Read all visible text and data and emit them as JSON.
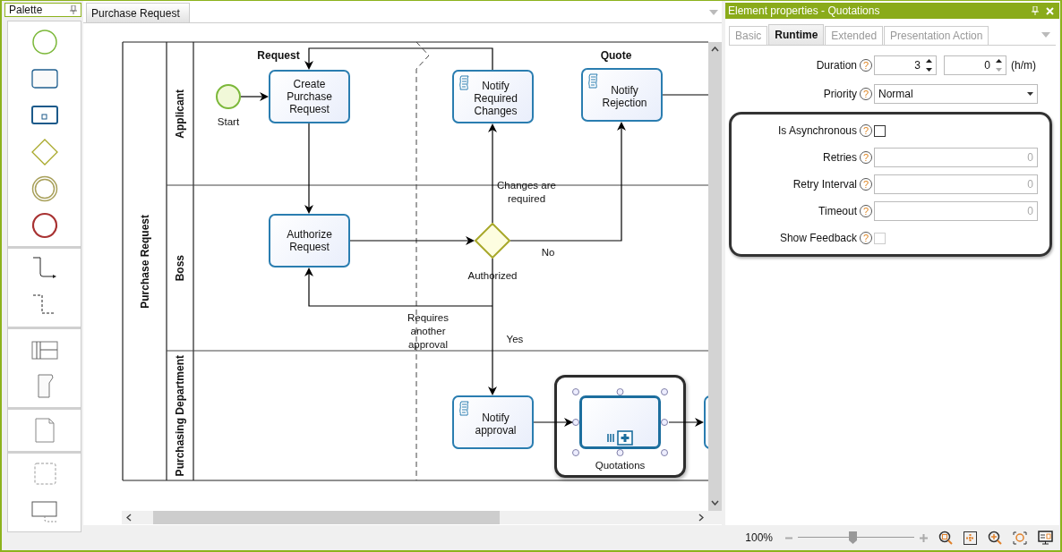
{
  "palette": {
    "title": "Palette"
  },
  "document_tabs": [
    {
      "label": "Purchase Request",
      "selected": true
    }
  ],
  "diagram": {
    "pool": "Purchase Request",
    "lanes": [
      {
        "name": "Applicant"
      },
      {
        "name": "Boss"
      },
      {
        "name": "Purchasing Department"
      }
    ],
    "phases": [
      "Request",
      "Quote"
    ],
    "nodes": [
      {
        "kind": "start",
        "label": "Start",
        "selected": false
      },
      {
        "kind": "task",
        "label": "Create Purchase Request",
        "selected": false
      },
      {
        "kind": "script",
        "label": "Notify Required Changes",
        "selected": false
      },
      {
        "kind": "script",
        "label": "Notify Rejection",
        "selected": false
      },
      {
        "kind": "task",
        "label": "Authorize Request",
        "selected": false
      },
      {
        "kind": "gateway",
        "label": "Authorized",
        "selected": false
      },
      {
        "kind": "script",
        "label": "Notify approval",
        "selected": false
      },
      {
        "kind": "subprocess",
        "label": "Quotations",
        "selected": true
      },
      {
        "kind": "task",
        "selected": false
      }
    ],
    "flow_labels": [
      "Changes are required",
      "No",
      "Requires another approval",
      "Yes"
    ]
  },
  "properties": {
    "title": "Element properties - Quotations",
    "tabs": [
      {
        "label": "Basic",
        "selected": false
      },
      {
        "label": "Runtime",
        "selected": true
      },
      {
        "label": "Extended",
        "selected": false
      },
      {
        "label": "Presentation Action",
        "selected": false
      }
    ],
    "fields": [
      {
        "kind": "duration",
        "label": "Duration",
        "help": "?",
        "hours": "3",
        "minutes": "0",
        "unit": "(h/m)",
        "highlighted": false
      },
      {
        "kind": "select",
        "label": "Priority",
        "help": "?",
        "value": "Normal",
        "highlighted": false
      },
      {
        "kind": "checkbox",
        "label": "Is Asynchronous",
        "help": "?",
        "checked": false,
        "disabled": false,
        "highlighted": true
      },
      {
        "kind": "number",
        "label": "Retries",
        "help": "?",
        "value": "0",
        "disabled": true,
        "highlighted": true
      },
      {
        "kind": "number",
        "label": "Retry Interval",
        "help": "?",
        "value": "0",
        "disabled": true,
        "highlighted": true
      },
      {
        "kind": "number",
        "label": "Timeout",
        "help": "?",
        "value": "0",
        "disabled": true,
        "highlighted": true
      },
      {
        "kind": "checkbox",
        "label": "Show Feedback",
        "help": "?",
        "checked": false,
        "disabled": true,
        "highlighted": true
      }
    ]
  },
  "status_bar": {
    "zoom": "100%",
    "level": 0.47
  }
}
